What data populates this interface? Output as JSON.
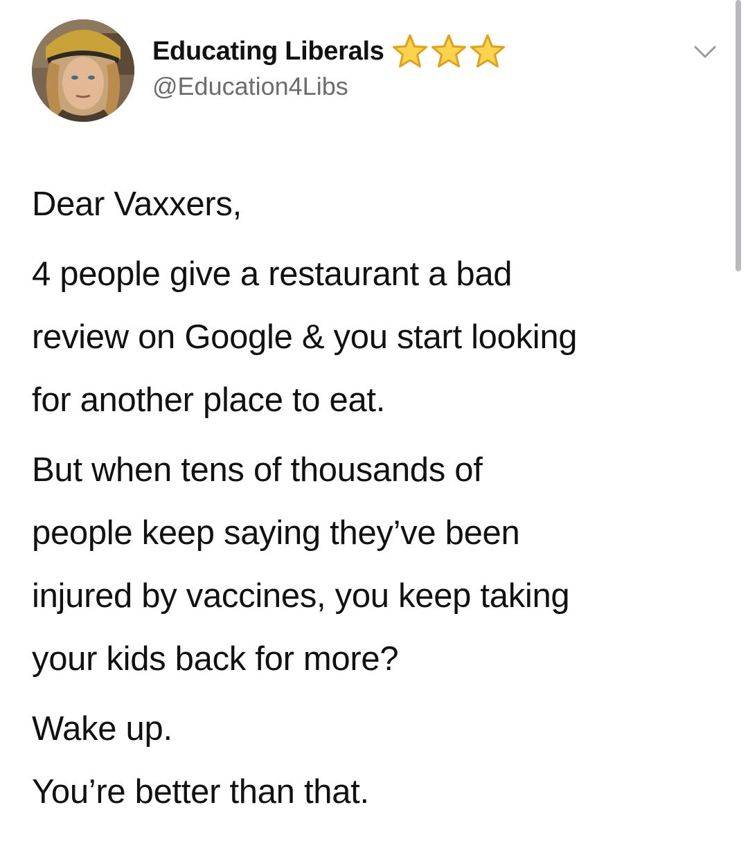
{
  "tweet": {
    "display_name": "Educating Liberals",
    "handle": "@Education4Libs",
    "badge_icons": [
      "star-emoji",
      "star-emoji",
      "star-emoji"
    ],
    "menu_icon": "chevron-down-icon",
    "body": {
      "greeting": "Dear Vaxxers,",
      "paragraph_1_lines": [
        "4 people give a restaurant a bad",
        "review on Google & you start looking",
        "for another place to eat."
      ],
      "paragraph_2_lines": [
        "But when tens of thousands of",
        "people keep saying they’ve been",
        "injured by vaccines, you keep taking",
        "your kids back for more?"
      ],
      "closing_lines": [
        "Wake up.",
        "You’re better than that."
      ]
    }
  },
  "colors": {
    "background": "#ffffff",
    "text": "#111111",
    "handle": "#6b6b70",
    "star_fill": "#fcd34d",
    "star_outline": "#e0a11b",
    "scrollbar": "#b9b9bd"
  }
}
